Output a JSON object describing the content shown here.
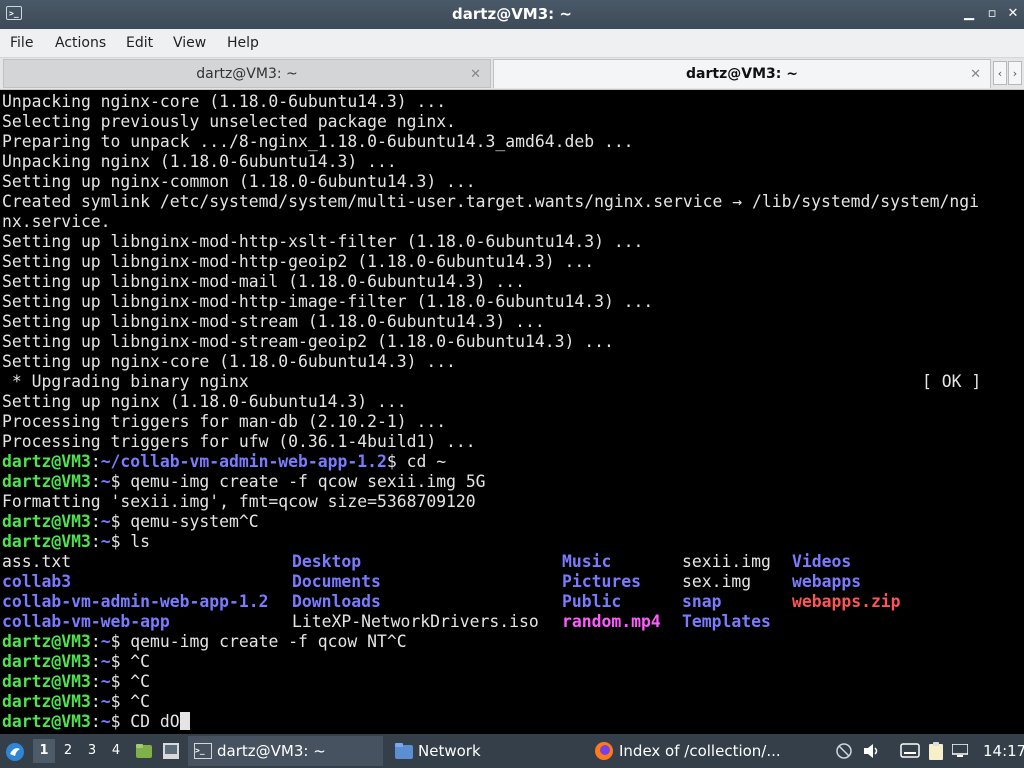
{
  "window": {
    "title": "dartz@VM3: ~"
  },
  "menu": [
    "File",
    "Actions",
    "Edit",
    "View",
    "Help"
  ],
  "tabs": [
    {
      "label": "dartz@VM3: ~",
      "active": false
    },
    {
      "label": "dartz@VM3: ~",
      "active": true
    }
  ],
  "terminal": {
    "lines": [
      "Unpacking nginx-core (1.18.0-6ubuntu14.3) ...",
      "Selecting previously unselected package nginx.",
      "Preparing to unpack .../8-nginx_1.18.0-6ubuntu14.3_amd64.deb ...",
      "Unpacking nginx (1.18.0-6ubuntu14.3) ...",
      "Setting up nginx-common (1.18.0-6ubuntu14.3) ...",
      "Created symlink /etc/systemd/system/multi-user.target.wants/nginx.service → /lib/systemd/system/ngi",
      "nx.service.",
      "Setting up libnginx-mod-http-xslt-filter (1.18.0-6ubuntu14.3) ...",
      "Setting up libnginx-mod-http-geoip2 (1.18.0-6ubuntu14.3) ...",
      "Setting up libnginx-mod-mail (1.18.0-6ubuntu14.3) ...",
      "Setting up libnginx-mod-http-image-filter (1.18.0-6ubuntu14.3) ...",
      "Setting up libnginx-mod-stream (1.18.0-6ubuntu14.3) ...",
      "Setting up libnginx-mod-stream-geoip2 (1.18.0-6ubuntu14.3) ...",
      "Setting up nginx-core (1.18.0-6ubuntu14.3) ...",
      " * Upgrading binary nginx",
      "Setting up nginx (1.18.0-6ubuntu14.3) ...",
      "Processing triggers for man-db (2.10.2-1) ...",
      "Processing triggers for ufw (0.36.1-4build1) ..."
    ],
    "ok_status": "[ OK ]",
    "prompt_user": "dartz@VM3",
    "prompt_colon": ":",
    "prompt_dollar": "$",
    "commands": [
      {
        "path": "~/collab-vm-admin-web-app-1.2",
        "cmd": " cd ~"
      },
      {
        "path": "~",
        "cmd": " qemu-img create -f qcow sexii.img 5G"
      },
      {
        "output": "Formatting 'sexii.img', fmt=qcow size=5368709120"
      },
      {
        "path": "~",
        "cmd": " qemu-system^C"
      },
      {
        "path": "~",
        "cmd": " ls"
      }
    ],
    "ls_columns": [
      [
        {
          "t": "ass.txt",
          "c": "plain"
        },
        {
          "t": "collab3",
          "c": "dir"
        },
        {
          "t": "collab-vm-admin-web-app-1.2",
          "c": "dir"
        },
        {
          "t": "collab-vm-web-app",
          "c": "dir"
        }
      ],
      [
        {
          "t": "Desktop",
          "c": "dir"
        },
        {
          "t": "Documents",
          "c": "dir"
        },
        {
          "t": "Downloads",
          "c": "dir"
        },
        {
          "t": "LiteXP-NetworkDrivers.iso",
          "c": "plain"
        }
      ],
      [
        {
          "t": "Music",
          "c": "dir"
        },
        {
          "t": "Pictures",
          "c": "dir"
        },
        {
          "t": "Public",
          "c": "dir"
        },
        {
          "t": "random.mp4",
          "c": "media"
        }
      ],
      [
        {
          "t": "sexii.img",
          "c": "plain"
        },
        {
          "t": "sex.img",
          "c": "plain"
        },
        {
          "t": "snap",
          "c": "dir"
        },
        {
          "t": "Templates",
          "c": "dir"
        }
      ],
      [
        {
          "t": "Videos",
          "c": "dir"
        },
        {
          "t": "webapps",
          "c": "dir"
        },
        {
          "t": "webapps.zip",
          "c": "archive"
        },
        {
          "t": "",
          "c": "plain"
        }
      ]
    ],
    "after_commands": [
      {
        "path": "~",
        "cmd": " qemu-img create -f qcow NT^C"
      },
      {
        "path": "~",
        "cmd": " ^C"
      },
      {
        "path": "~",
        "cmd": " ^C"
      },
      {
        "path": "~",
        "cmd": " ^C"
      },
      {
        "path": "~",
        "cmd": " CD dO"
      }
    ]
  },
  "colors": {
    "prompt": "#4ee44e",
    "path": "#7b7bff",
    "archive": "#ff5555",
    "media": "#ff5cff",
    "panel": "#343f4a"
  },
  "taskbar": {
    "workspaces": [
      "1",
      "2",
      "3",
      "4"
    ],
    "tasks": [
      {
        "label": "dartz@VM3: ~",
        "icon": "terminal-icon"
      },
      {
        "label": "Network",
        "icon": "folder-icon"
      },
      {
        "label": "Index of /collection/...",
        "icon": "firefox-icon"
      }
    ],
    "clock": "14:17"
  }
}
